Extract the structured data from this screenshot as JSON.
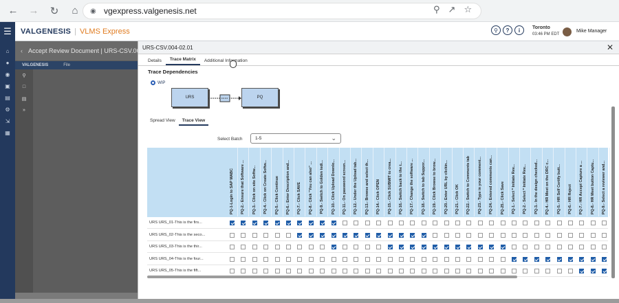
{
  "browser": {
    "url": "vgexpress.valgenesis.net",
    "back_icon": "back-arrow-icon",
    "forward_icon": "forward-arrow-icon",
    "reload_icon": "reload-icon",
    "home_icon": "home-icon"
  },
  "header": {
    "brand": "VALGENESIS",
    "product": "VLMS Express",
    "location": "Toronto",
    "time": "03:46 PM  EDT",
    "user": "Mike Manager"
  },
  "behind": {
    "title": "Accept Review Document | URS-CSV.004-02.0",
    "brand": "VALGENESIS",
    "menu": "File"
  },
  "modal": {
    "title": "URS-CSV.004-02.01",
    "tabs": [
      "Details",
      "Trace Matrix",
      "Additional Information"
    ],
    "active_tab": "Trace Matrix",
    "section_title": "Trace Dependencies",
    "wip_label": "WIP",
    "diagram": {
      "left": "URS",
      "right": "PQ"
    },
    "view_tabs": [
      "Spread View",
      "Trace View"
    ],
    "active_view": "Trace View",
    "batch_label": "Select Batch",
    "batch_value": "1-5"
  },
  "columns": [
    "PQ-1-Login to SAP MABC",
    "PQ-2.- Ensure that Software ...",
    "PQ-3.- Click on site Softw...",
    "PQ-4.- Click on Create Softw...",
    "PQ-5.- Click Continue",
    "PQ-6.- Enter Description and...",
    "PQ-7.- Click SAVE",
    "PQ-8.- Click \"You can also\" ...",
    "PQ-9.- Switch to Golden tedi...",
    "PQ-10.- Click Upload Downlo...",
    "PQ-11.- On password screen...",
    "PQ-12.- Under the Upload tab...",
    "PQ-13.- Browse and select th...",
    "PQ-14.- Click OPEN",
    "PQ-15.- Click SUBMIT to crea...",
    "PQ-16.- Switch back to the t...",
    "PQ-17.- Change the software ...",
    "PQ-18.- Switch to tab Suppor...",
    "PQ-19.- Click Browse to brow...",
    "PQ-20.- Enter URL by clickin...",
    "PQ-21.- Click OK",
    "PQ-22.- Switch to Comments tab",
    "PQ-23.- Type in your comment...",
    "PQ-24.- Entered comments can...",
    "PQ-25.- Click Save",
    "PQ-1.- Select * Initiate Rev...",
    "PQ-2.- Select * Initiate Rev...",
    "PQ-3.- In the design checked...",
    "PQ-4.- HR Meet on the DRC c...",
    "PQ-5.- HR Self Certify butt...",
    "PQ-6.- HR Reject",
    "PQ-7.- HR Accept Capture a ...",
    "PQ-8.- HR Meet button Captu...",
    "PQ-9.- Select a reviewer and..."
  ],
  "rows": [
    {
      "label": "URS URS_01-This is the firs...",
      "checks": [
        1,
        1,
        1,
        1,
        1,
        1,
        1,
        1,
        1,
        1,
        0,
        0,
        0,
        0,
        0,
        0,
        0,
        0,
        0,
        0,
        0,
        0,
        0,
        0,
        0,
        0,
        0,
        0,
        0,
        0,
        0,
        0,
        0,
        0
      ]
    },
    {
      "label": "URS URS_02-This is the seco...",
      "checks": [
        0,
        0,
        0,
        0,
        0,
        0,
        1,
        1,
        1,
        1,
        1,
        1,
        1,
        1,
        1,
        1,
        1,
        1,
        0,
        0,
        0,
        0,
        0,
        0,
        0,
        0,
        0,
        0,
        0,
        0,
        0,
        0,
        0,
        0
      ]
    },
    {
      "label": "URS URS_03-This is the thir...",
      "checks": [
        0,
        0,
        0,
        0,
        0,
        0,
        0,
        0,
        0,
        1,
        0,
        0,
        0,
        0,
        1,
        1,
        1,
        1,
        1,
        1,
        1,
        1,
        1,
        1,
        1,
        0,
        0,
        0,
        0,
        0,
        0,
        0,
        0,
        0
      ]
    },
    {
      "label": "URS URS_04-This is the four...",
      "checks": [
        0,
        0,
        0,
        0,
        0,
        0,
        0,
        0,
        0,
        0,
        0,
        0,
        0,
        0,
        0,
        0,
        0,
        0,
        0,
        0,
        0,
        0,
        0,
        0,
        0,
        1,
        1,
        1,
        1,
        1,
        1,
        1,
        1,
        1
      ]
    },
    {
      "label": "URS URS_05-This is the fift...",
      "checks": [
        0,
        0,
        0,
        0,
        0,
        0,
        0,
        0,
        0,
        0,
        0,
        0,
        0,
        0,
        0,
        0,
        0,
        0,
        0,
        0,
        0,
        0,
        0,
        0,
        0,
        0,
        0,
        0,
        0,
        0,
        0,
        1,
        1,
        1
      ]
    }
  ]
}
